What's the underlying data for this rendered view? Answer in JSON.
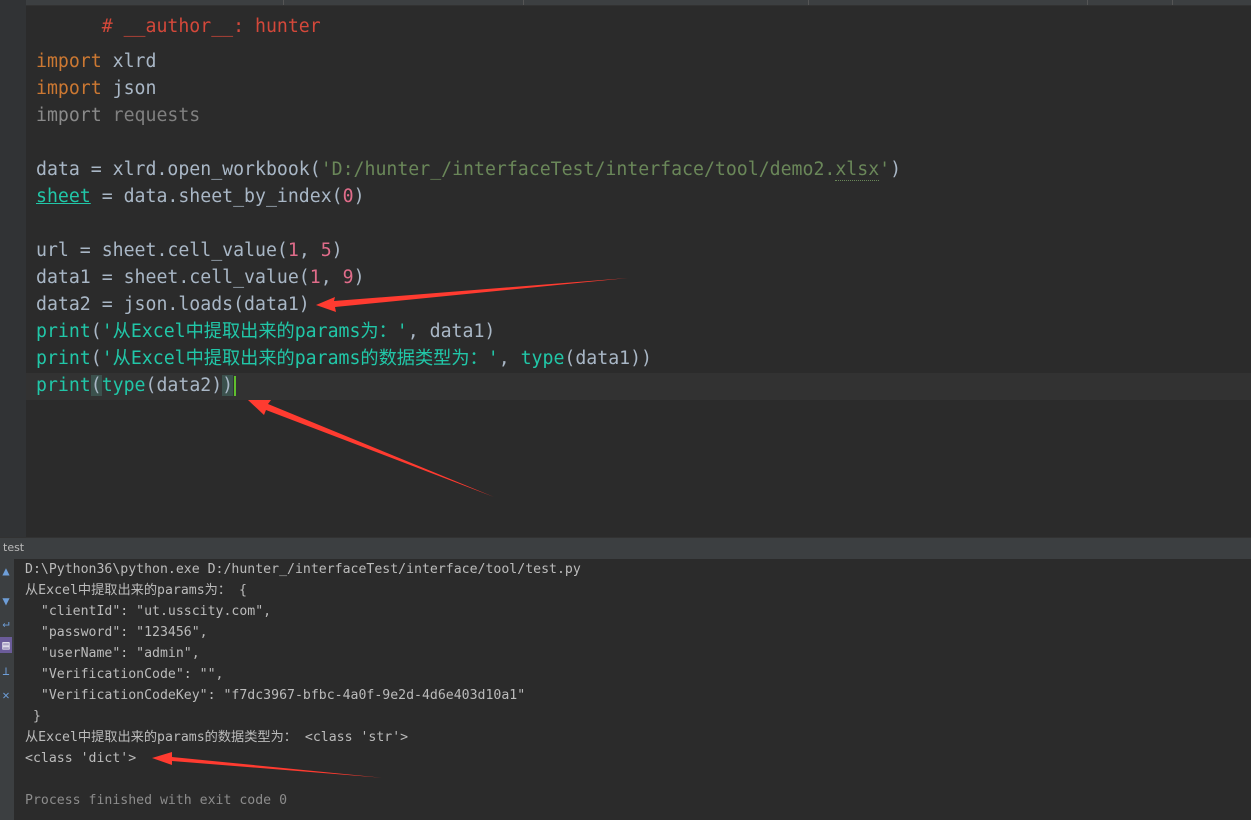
{
  "editor": {
    "lines": {
      "comment": "# __author__: hunter",
      "import1_kw": "import",
      "import1_mod": " xlrd",
      "import2_kw": "import",
      "import2_mod": " json",
      "import3_kw": "import",
      "import3_mod": " requests",
      "data_a": "data = xlrd.open_workbook(",
      "data_str_a": "'D:/hunter_/interfaceTest/interface/tool/demo2.",
      "data_str_b": "xlsx",
      "data_str_c": "'",
      "data_b": ")",
      "sheet_var": "sheet",
      "sheet_a": " = data.sheet_by_index(",
      "sheet_num": "0",
      "sheet_b": ")",
      "url_a": "url = sheet.cell_value(",
      "url_n1": "1",
      "url_sep": ", ",
      "url_n2": "5",
      "url_b": ")",
      "data1_a": "data1 = sheet.cell_value(",
      "data1_n1": "1",
      "data1_sep": ", ",
      "data1_n2": "9",
      "data1_b": ")",
      "data2_a": "data2 = json.loads(data1)",
      "print1_fn": "print",
      "print1_open": "(",
      "print1_str": "'从Excel中提取出来的params为：'",
      "print1_rest": ", data1)",
      "print2_fn": "print",
      "print2_open": "(",
      "print2_str": "'从Excel中提取出来的params的数据类型为：'",
      "print2_mid": ", ",
      "print2_type": "type",
      "print2_rest": "(data1))",
      "print3_fn": "print",
      "print3_open": "(",
      "print3_type": "type",
      "print3_mid": "(data2)",
      "print3_close": ")"
    }
  },
  "run": {
    "title": "test",
    "toolbar_icons": [
      "up-arrow-icon",
      "down-arrow-icon",
      "wrap-icon",
      "print-icon",
      "pin-icon",
      "delete-icon"
    ],
    "console": [
      "D:\\Python36\\python.exe D:/hunter_/interfaceTest/interface/tool/test.py",
      "从Excel中提取出来的params为： {",
      "  \"clientId\": \"ut.usscity.com\",",
      "  \"password\": \"123456\",",
      "  \"userName\": \"admin\",",
      "  \"VerificationCode\": \"\",",
      "  \"VerificationCodeKey\": \"f7dc3967-bfbc-4a0f-9e2d-4d6e403d10a1\"",
      " }",
      "从Excel中提取出来的params的数据类型为： <class 'str'>",
      "<class 'dict'>",
      "",
      "Process finished with exit code 0"
    ]
  },
  "colors": {
    "background": "#2b2b2b",
    "keyword": "#cc7832",
    "string": "#6a8759",
    "builtin": "#8888c6",
    "annotation_arrow": "#ff3b30"
  }
}
